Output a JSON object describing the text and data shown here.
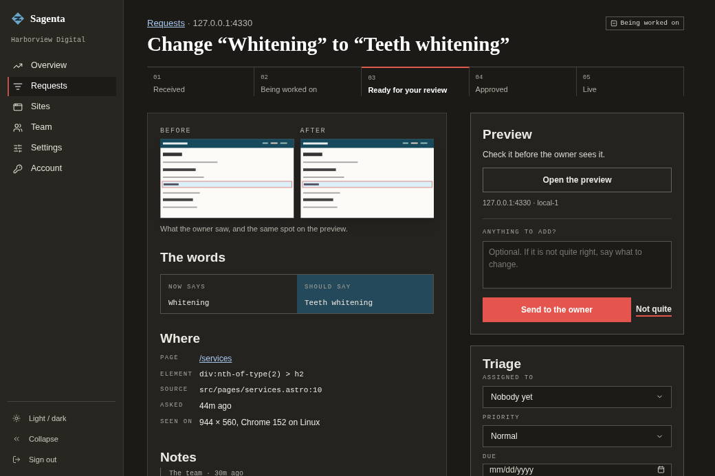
{
  "sidebar": {
    "brand": "Sagenta",
    "workspace": "Harborview Digital",
    "items": [
      {
        "label": "Overview",
        "selected": false
      },
      {
        "label": "Requests",
        "selected": true
      },
      {
        "label": "Sites",
        "selected": false
      },
      {
        "label": "Team",
        "selected": false
      },
      {
        "label": "Settings",
        "selected": false
      },
      {
        "label": "Account",
        "selected": false
      }
    ],
    "footer": [
      {
        "label": "Light / dark"
      },
      {
        "label": "Collapse"
      },
      {
        "label": "Sign out"
      }
    ]
  },
  "header": {
    "breadcrumb_link": "Requests",
    "breadcrumb_rest": " · 127.0.0.1:4330",
    "title": "Change “Whitening” to “Teeth whitening”",
    "status_badge": "Being worked on"
  },
  "steps": [
    {
      "number": "01",
      "label": "Received",
      "selected": false
    },
    {
      "number": "02",
      "label": "Being worked on",
      "selected": false
    },
    {
      "number": "03",
      "label": "Ready for your review",
      "selected": true
    },
    {
      "number": "04",
      "label": "Approved",
      "selected": false
    },
    {
      "number": "05",
      "label": "Live",
      "selected": false
    }
  ],
  "comparison": {
    "shots": [
      {
        "label": "BEFORE"
      },
      {
        "label": "AFTER"
      }
    ],
    "caption": "What the owner saw, and the same spot on the preview."
  },
  "words": {
    "title": "The words",
    "now_label": "NOW SAYS",
    "now": "Whitening",
    "should_label": "SHOULD SAY",
    "should": "Teeth whitening"
  },
  "where": {
    "title": "Where",
    "rows": [
      {
        "label": "PAGE",
        "value": "/services",
        "kind": "link"
      },
      {
        "label": "ELEMENT",
        "value": "div:nth-of-type(2) > h2",
        "kind": "code"
      },
      {
        "label": "SOURCE",
        "value": "src/pages/services.astro:10",
        "kind": "code"
      },
      {
        "label": "ASKED",
        "value": "44m ago",
        "kind": "text"
      },
      {
        "label": "SEEN ON",
        "value": "944 × 560, Chrome 152 on Linux",
        "kind": "text"
      }
    ]
  },
  "notes": {
    "title": "Notes",
    "first_note_meta": "The team · 30m ago"
  },
  "preview": {
    "title": "Preview",
    "subtitle": "Check it before the owner sees it.",
    "open_button": "Open the preview",
    "address": "127.0.0.1:4330 · local-1",
    "add_label": "ANYTHING TO ADD?",
    "add_placeholder": "Optional. If it is not quite right, say what to change.",
    "send_button": "Send to the owner",
    "reject_link": "Not quite"
  },
  "triage": {
    "title": "Triage",
    "assigned_label": "ASSIGNED TO",
    "assigned": "Nobody yet",
    "priority_label": "PRIORITY",
    "priority": "Normal",
    "due_label": "DUE",
    "due_placeholder": "mm/dd/yyyy"
  }
}
